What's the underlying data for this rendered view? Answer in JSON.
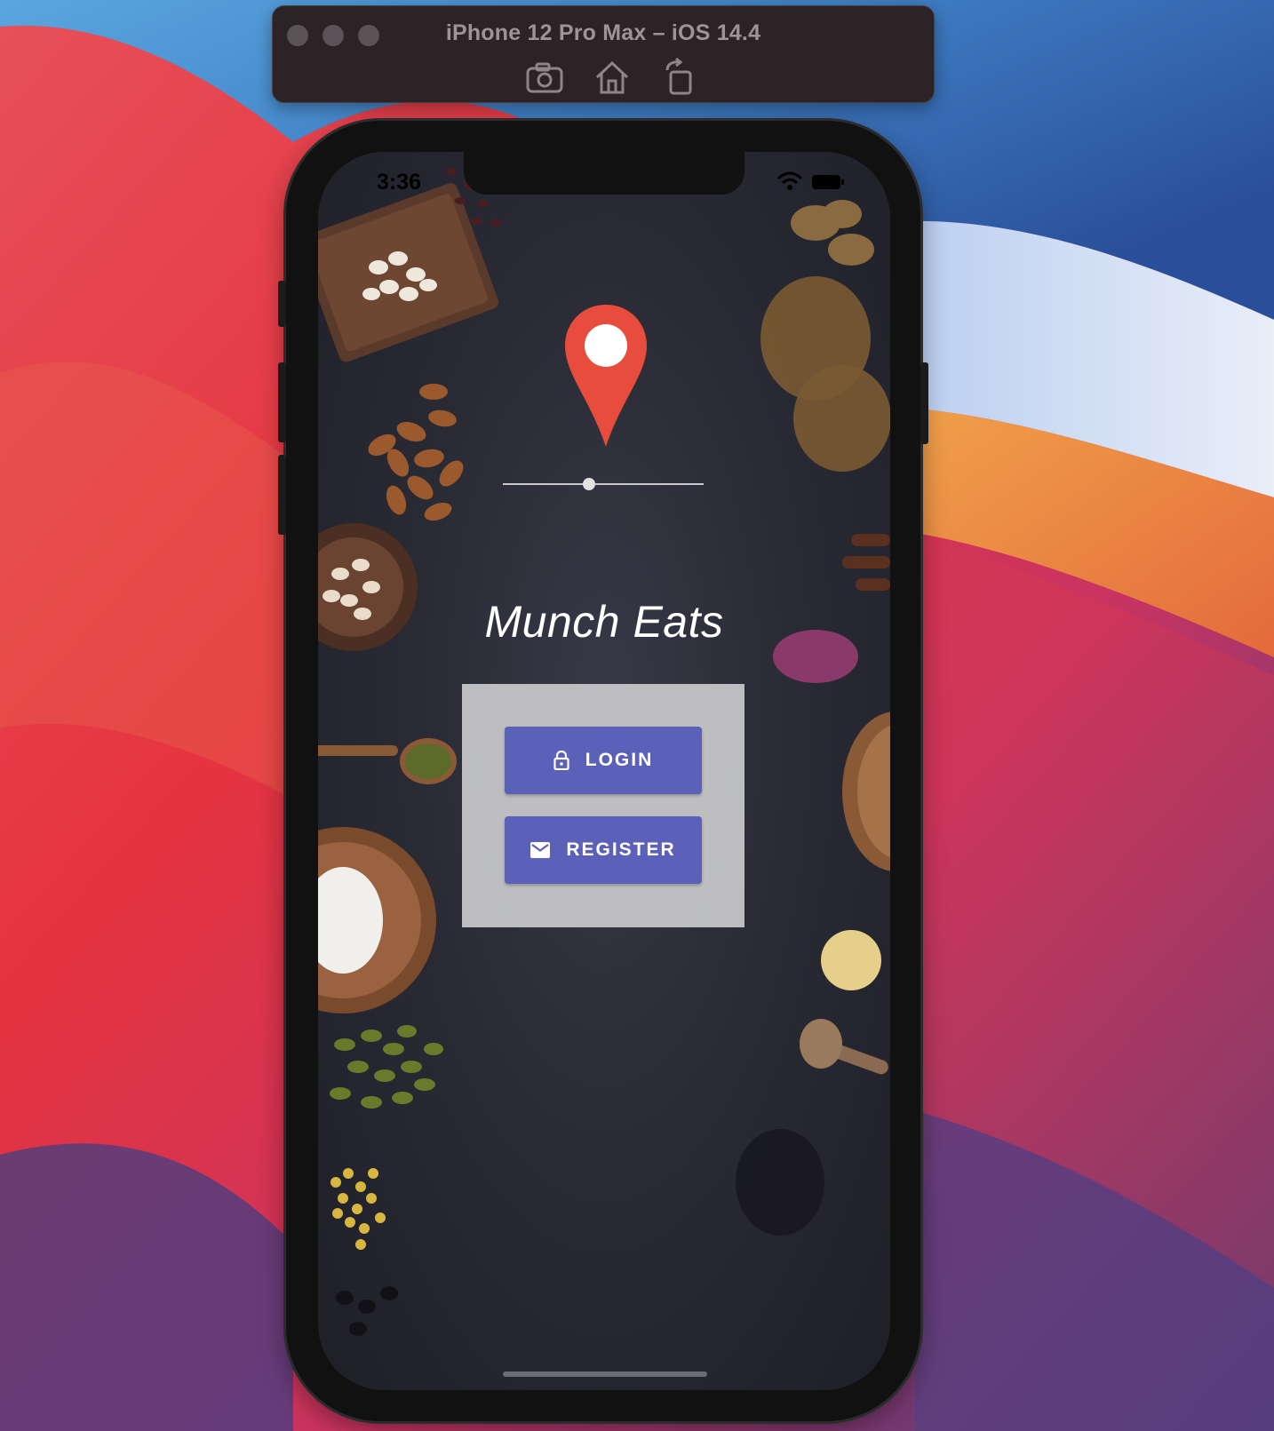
{
  "window": {
    "title": "iPhone 12 Pro Max – iOS 14.4"
  },
  "toolbar": {
    "icons": [
      "screenshot-icon",
      "home-icon",
      "rotate-icon"
    ]
  },
  "status_bar": {
    "time": "3:36",
    "icons": [
      "wifi-icon",
      "battery-icon"
    ]
  },
  "app": {
    "title": "Munch Eats",
    "logo_icon": "map-pin-icon",
    "slider_value_fraction": 0.43,
    "colors": {
      "accent": "#5b60b8",
      "pin": "#e74c3c"
    }
  },
  "auth": {
    "login_label": "LOGIN",
    "login_icon": "lock-icon",
    "register_label": "REGISTER",
    "register_icon": "mail-icon"
  }
}
